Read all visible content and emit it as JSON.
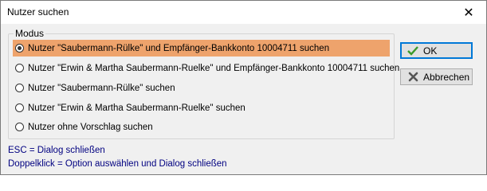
{
  "window": {
    "title": "Nutzer suchen",
    "close_glyph": "✕"
  },
  "group": {
    "label": "Modus"
  },
  "options": [
    {
      "label": "Nutzer \"Saubermann-Rülke\" und Empfänger-Bankkonto 10004711 suchen",
      "selected": true
    },
    {
      "label": "Nutzer \"Erwin & Martha Saubermann-Ruelke\" und Empfänger-Bankkonto 10004711 suchen",
      "selected": false
    },
    {
      "label": "Nutzer \"Saubermann-Rülke\" suchen",
      "selected": false
    },
    {
      "label": "Nutzer \"Erwin & Martha Saubermann-Ruelke\" suchen",
      "selected": false
    },
    {
      "label": "Nutzer ohne Vorschlag suchen",
      "selected": false
    }
  ],
  "buttons": {
    "ok": {
      "label": "OK",
      "icon": "check-icon"
    },
    "cancel": {
      "label": "Abbrechen",
      "icon": "x-icon"
    }
  },
  "hints": {
    "esc": "ESC = Dialog schließen",
    "doubleclick": "Doppelklick = Option auswählen und Dialog schließen"
  },
  "colors": {
    "selection": "#eea36c",
    "hint_text": "#000080",
    "ok_check": "#3a9a2a"
  }
}
